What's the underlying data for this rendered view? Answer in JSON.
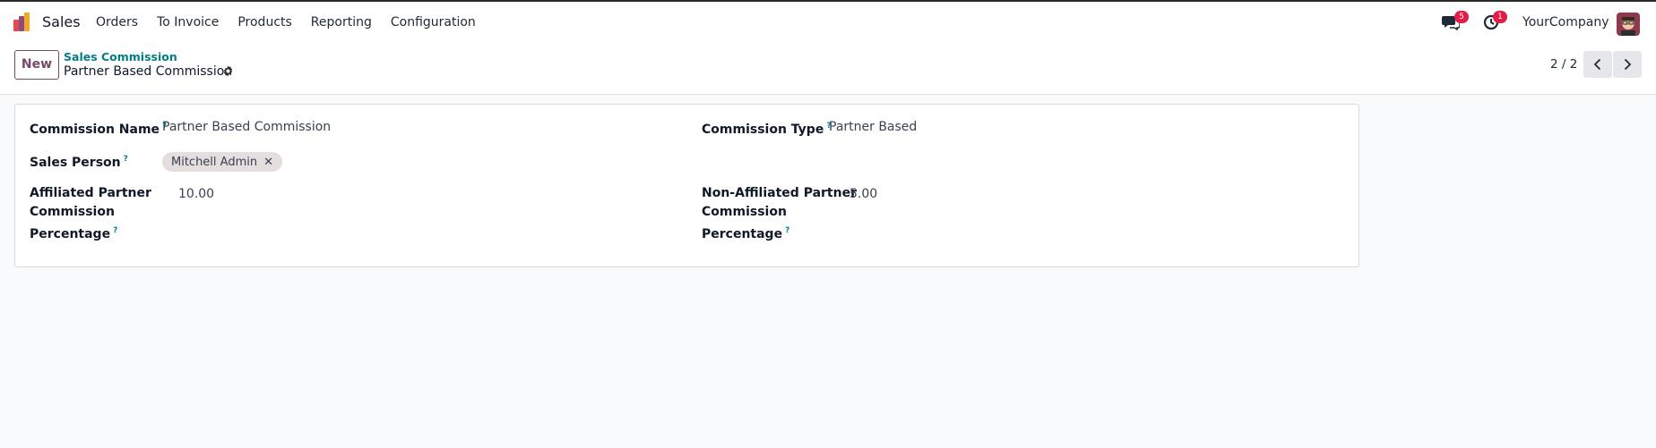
{
  "navbar": {
    "app_name": "Sales",
    "menu": [
      "Orders",
      "To Invoice",
      "Products",
      "Reporting",
      "Configuration"
    ],
    "messages_count": "5",
    "activities_count": "1",
    "company": "YourCompany"
  },
  "control_panel": {
    "new_label": "New",
    "breadcrumb_parent": "Sales Commission",
    "breadcrumb_current": "Partner Based Commission",
    "pager": "2 / 2"
  },
  "form": {
    "commission_name_label": "Commission Name",
    "commission_name_value": "Partner Based Commission",
    "commission_type_label": "Commission Type",
    "commission_type_value": "Partner Based",
    "sales_person_label": "Sales Person",
    "sales_person_tag": "Mitchell Admin",
    "affiliated_label_1": "Affiliated Partner",
    "affiliated_label_2": "Commission",
    "affiliated_label_3": "Percentage",
    "affiliated_value": "10.00",
    "non_affiliated_label_1": "Non-Affiliated Partner",
    "non_affiliated_label_2": "Commission",
    "non_affiliated_label_3": "Percentage",
    "non_affiliated_value": "5.00",
    "help_mark": "?"
  },
  "colors": {
    "brand": "#714b67",
    "link": "#017e84",
    "badge": "#e11d48"
  }
}
